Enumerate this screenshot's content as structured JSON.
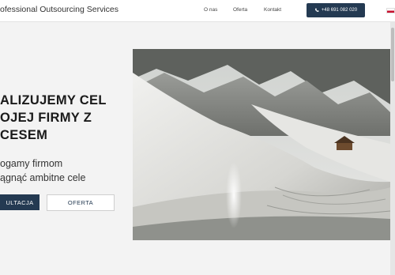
{
  "header": {
    "brand": "ofessional Outsourcing Services",
    "nav": [
      "O nas",
      "Oferta",
      "Kontakt"
    ],
    "phone": "+48 691 082 020"
  },
  "hero": {
    "headline": "ALIZUJEMY CEL\nOJEJ FIRMY Z\nCESEM",
    "subtext": "ogamy firmom\nągnąć ambitne cele",
    "buttons": {
      "primary": "ULTACJA",
      "secondary": "OFERTA"
    },
    "image": "snowy-mountain-slope-with-hut"
  },
  "colors": {
    "accent": "#243a52"
  }
}
